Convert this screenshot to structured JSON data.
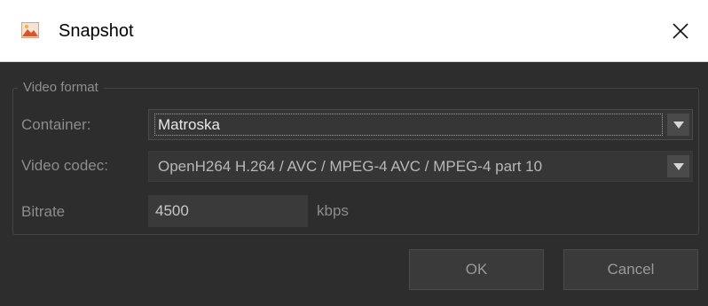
{
  "window": {
    "title": "Snapshot",
    "icon": "snapshot-image-icon",
    "close_icon": "close-icon"
  },
  "group": {
    "title": "Video format"
  },
  "container": {
    "label": "Container:",
    "selected": "Matroska"
  },
  "video_codec": {
    "label": "Video codec:",
    "selected": "OpenH264 H.264 / AVC / MPEG-4 AVC / MPEG-4 part 10"
  },
  "bitrate": {
    "label": "Bitrate",
    "value": "4500",
    "unit": "kbps"
  },
  "buttons": {
    "ok": "OK",
    "cancel": "Cancel"
  },
  "colors": {
    "background": "#2d2d2d",
    "titlebar": "#ffffff",
    "field": "#363636",
    "button": "#3a3a3a"
  }
}
